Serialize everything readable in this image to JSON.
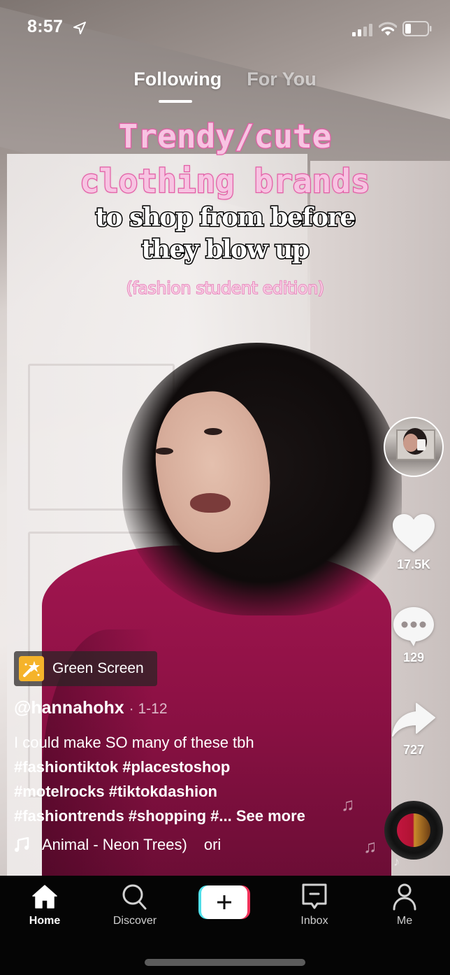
{
  "status_bar": {
    "time": "8:57",
    "location_icon": "location-arrow-icon",
    "signal_icon": "cellular-signal-icon",
    "wifi_icon": "wifi-icon",
    "battery_icon": "battery-low-icon"
  },
  "feed_tabs": [
    {
      "label": "Following",
      "active": true
    },
    {
      "label": "For You",
      "active": false
    }
  ],
  "video_overlay": {
    "line1": "Trendy/cute",
    "line2": "clothing brands",
    "line3": "to shop from before",
    "line4": "they blow up",
    "line5": "(fashion student edition)"
  },
  "actions": {
    "avatar_icon": "creator-avatar",
    "like_icon": "heart-icon",
    "likes": "17.5K",
    "comment_icon": "comment-bubble-icon",
    "comments": "129",
    "share_icon": "share-arrow-icon",
    "shares": "727",
    "sound_disc_icon": "music-disc-icon"
  },
  "post": {
    "effect_label": "Green Screen",
    "effect_icon": "magic-wand-icon",
    "username": "@hannahohx",
    "date": "· 1-12",
    "caption_text": "I could make SO many of these tbh",
    "hashtags_line1": "#fashiontiktok #placestoshop",
    "hashtags_line2": "#motelrocks #tiktokdashion",
    "hashtags_line3": "#fashiontrends #shopping #...",
    "see_more": "See more",
    "music_icon": "music-note-icon",
    "music_title": "Animal - Neon Trees)",
    "music_scroll": "ori"
  },
  "bottom_nav": {
    "items": [
      {
        "label": "Home",
        "icon": "home-icon",
        "active": true
      },
      {
        "label": "Discover",
        "icon": "search-icon",
        "active": false
      },
      {
        "label": "",
        "icon": "plus-icon",
        "active": false
      },
      {
        "label": "Inbox",
        "icon": "inbox-icon",
        "active": false
      },
      {
        "label": "Me",
        "icon": "profile-icon",
        "active": false
      }
    ]
  },
  "colors": {
    "overlay_pink_fill": "#f7c4e2",
    "overlay_pink_stroke": "#e35fa6",
    "effect_badge": "#f5b32a",
    "create_cyan": "#4fe0ea",
    "create_red": "#f2325a",
    "nav_background": "#050505"
  }
}
